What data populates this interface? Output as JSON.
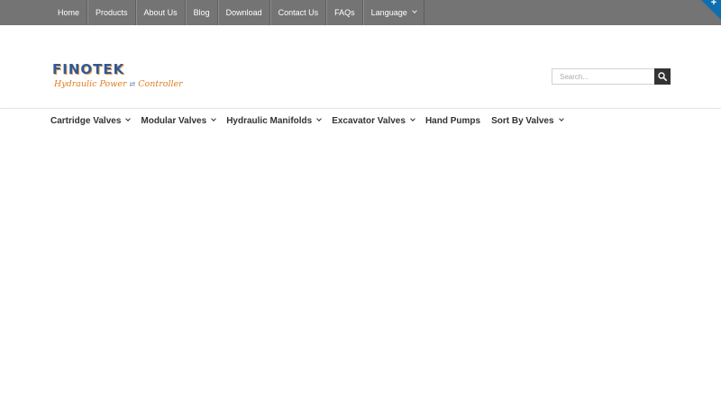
{
  "topbar": {
    "items": [
      {
        "label": "Home"
      },
      {
        "label": "Products"
      },
      {
        "label": "About Us"
      },
      {
        "label": "Blog"
      },
      {
        "label": "Download"
      },
      {
        "label": "Contact Us"
      },
      {
        "label": "FAQs"
      },
      {
        "label": "Language"
      }
    ],
    "corner_label": "+",
    "background": "#747474",
    "corner_color": "#0d6fb0"
  },
  "header": {
    "logo": {
      "wordmark": "FINOTEK",
      "tagline_part1": "Hydraulic Power",
      "tagline_part2": "Controller"
    },
    "search": {
      "placeholder": "Search...",
      "icon": "search-icon"
    }
  },
  "mainnav": {
    "items": [
      {
        "label": "Cartridge Valves"
      },
      {
        "label": "Modular Valves"
      },
      {
        "label": "Hydraulic Manifolds"
      },
      {
        "label": "Excavator Valves"
      },
      {
        "label": "Hand Pumps"
      },
      {
        "label": "Sort By Valves"
      }
    ]
  }
}
